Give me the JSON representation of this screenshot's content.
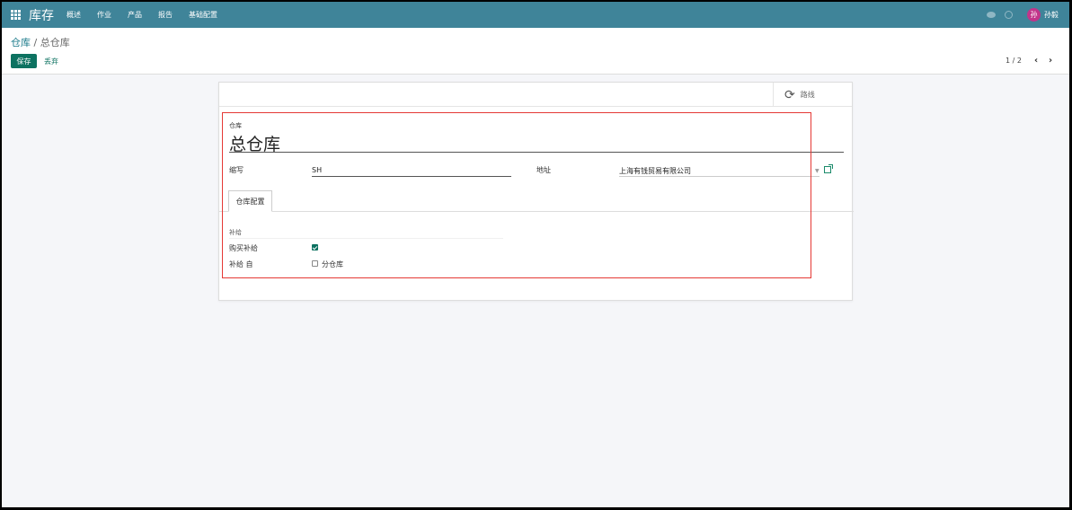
{
  "navbar": {
    "app_name": "库存",
    "menu": [
      "概述",
      "作业",
      "产品",
      "报告",
      "基础配置"
    ],
    "user_initial": "孙",
    "user_name": "孙毅",
    "color": "#3f8499"
  },
  "breadcrumb": {
    "parent": "仓库",
    "separator": " / ",
    "current": "总仓库"
  },
  "toolbar": {
    "save_label": "保存",
    "discard_label": "丢弃",
    "pager": "1 / 2",
    "prev_icon": "chevron-left-icon",
    "next_icon": "chevron-right-icon"
  },
  "smart_button": {
    "icon": "refresh-icon",
    "label": "路线"
  },
  "form": {
    "title_label": "仓库",
    "title_value": "总仓库",
    "code_label": "缩写",
    "code_value": "SH",
    "address_label": "地址",
    "address_value": "上海有钱贸易有限公司",
    "tab_label": "仓库配置",
    "group_title": "补给",
    "buy_label": "购买补给",
    "buy_checked": true,
    "resupply_label": "补给 自",
    "resupply_option": "分仓库",
    "resupply_checked": false
  },
  "colors": {
    "primary": "#0d7261",
    "highlight": "#e53935"
  }
}
